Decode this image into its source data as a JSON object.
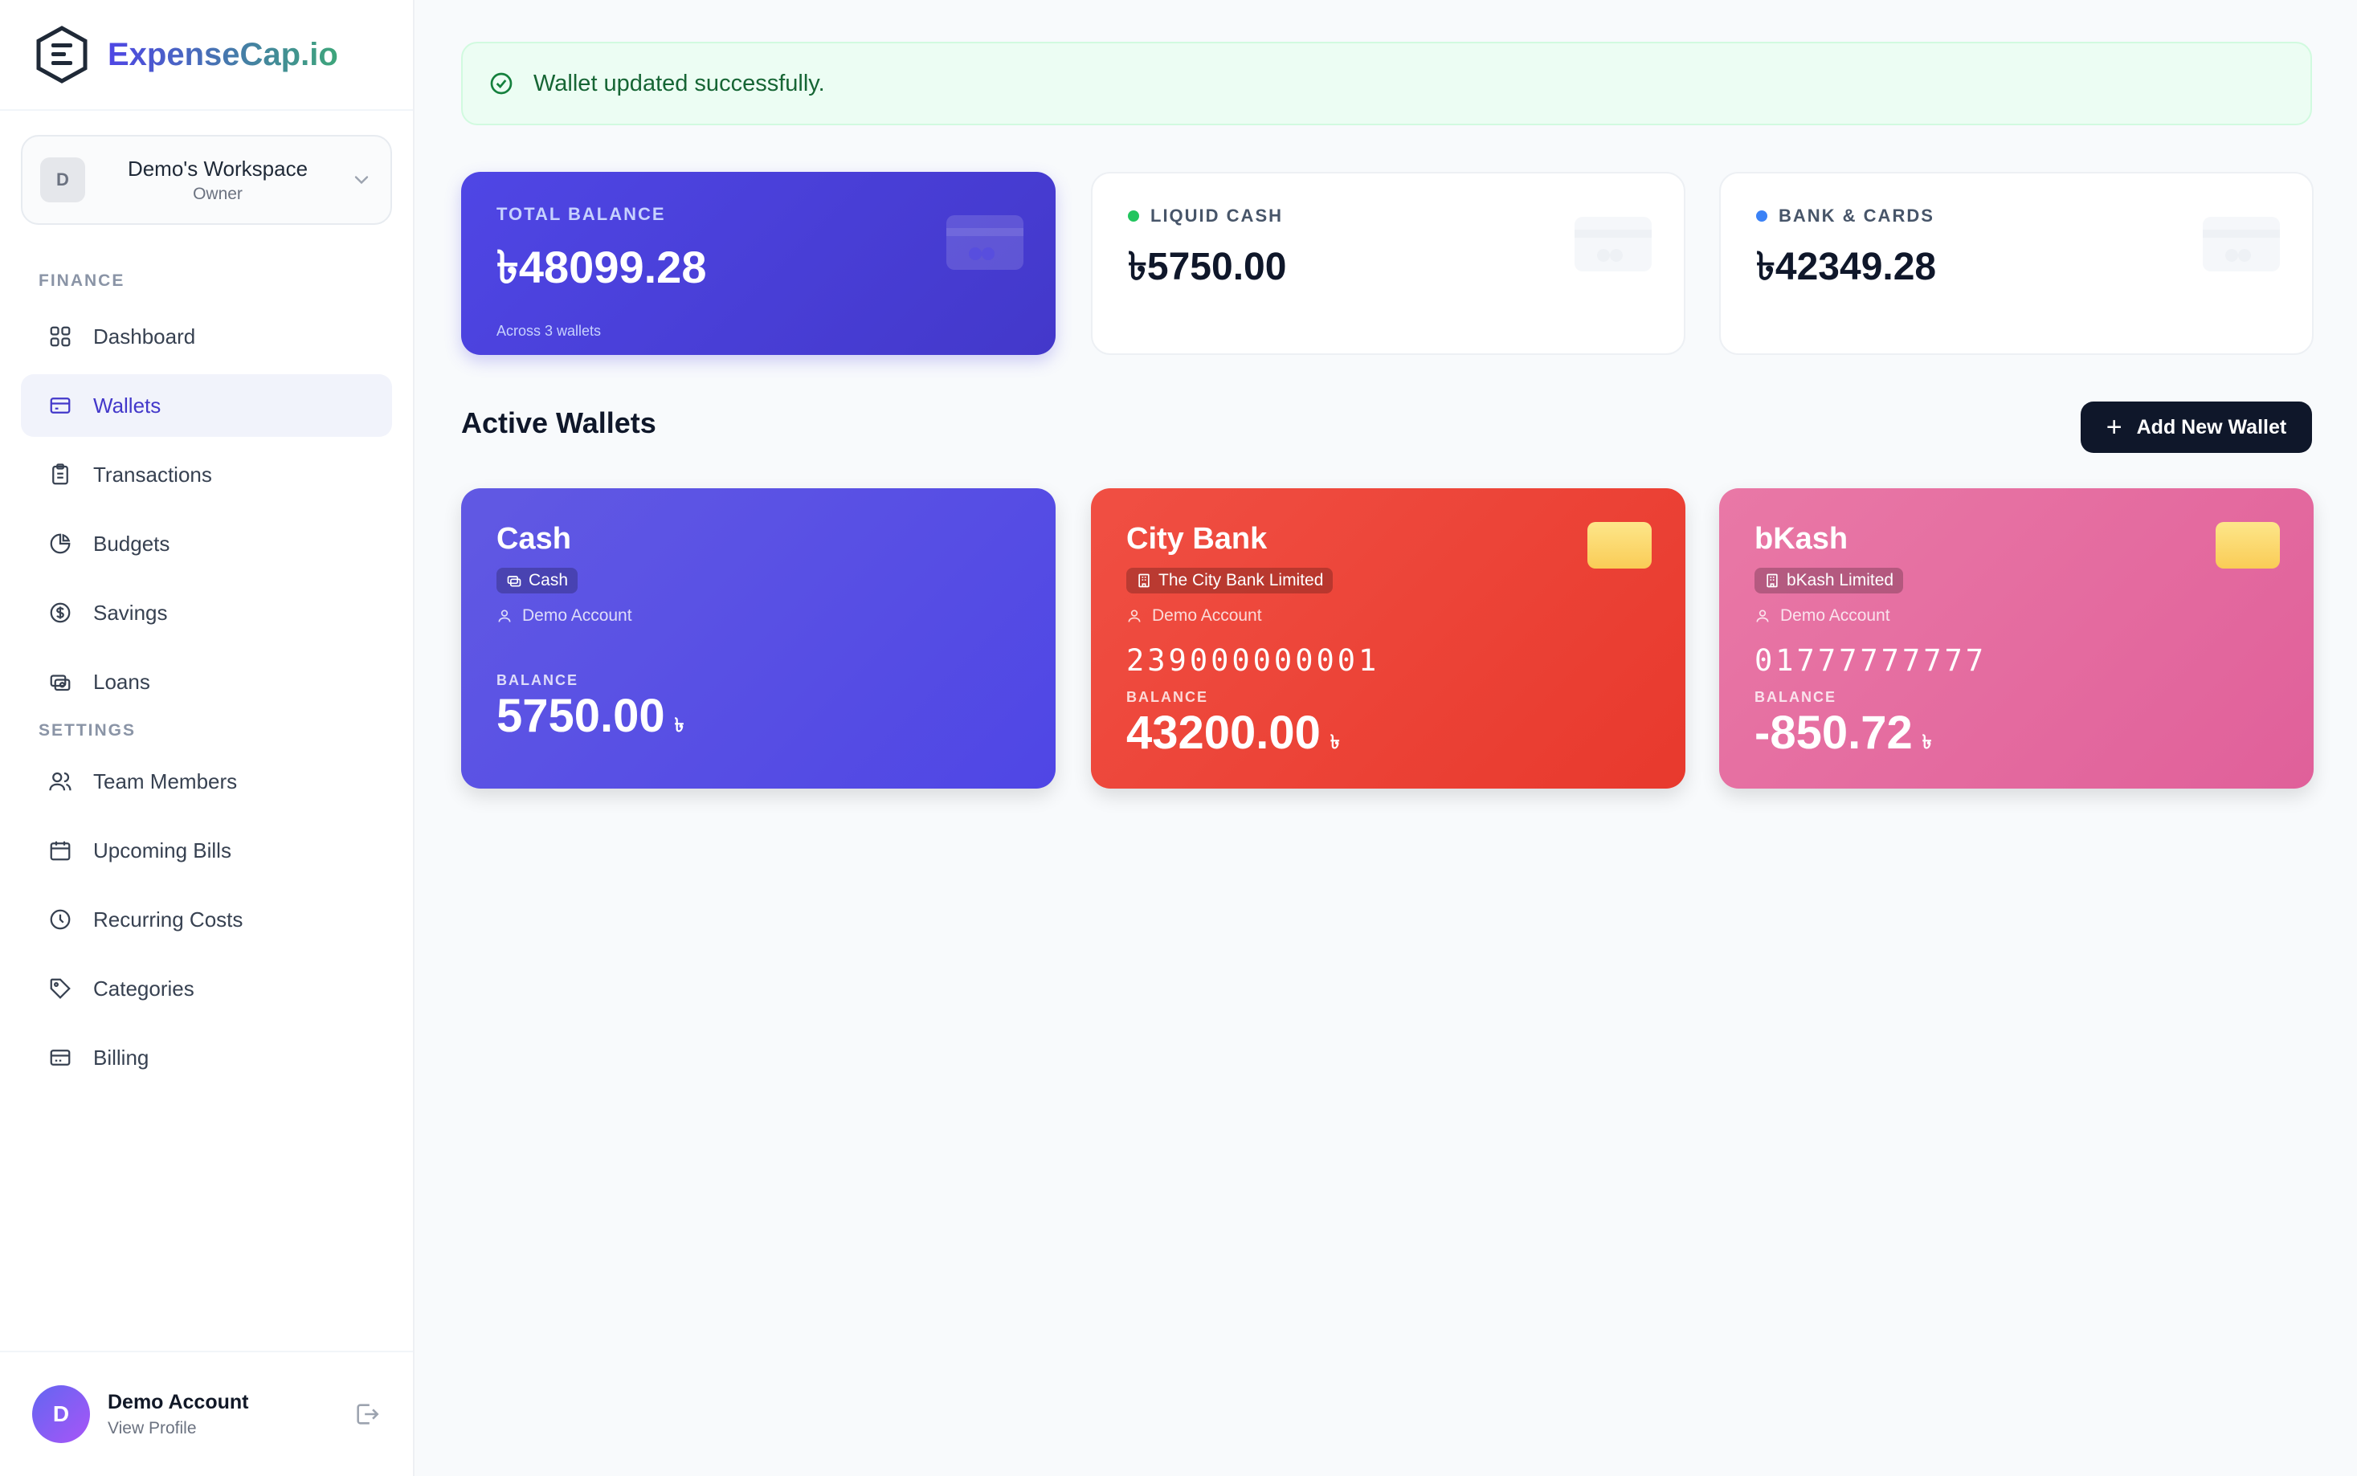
{
  "brand": {
    "name": "ExpenseCap.io",
    "accent": "#4f46e5"
  },
  "workspace": {
    "initial": "D",
    "name": "Demo's Workspace",
    "role": "Owner"
  },
  "nav": {
    "finance_label": "FINANCE",
    "settings_label": "SETTINGS",
    "finance": [
      {
        "label": "Dashboard",
        "icon": "grid-icon"
      },
      {
        "label": "Wallets",
        "icon": "wallet-icon",
        "active": true
      },
      {
        "label": "Transactions",
        "icon": "clipboard-icon"
      },
      {
        "label": "Budgets",
        "icon": "pie-chart-icon"
      },
      {
        "label": "Savings",
        "icon": "dollar-icon"
      },
      {
        "label": "Loans",
        "icon": "cash-icon"
      }
    ],
    "settings": [
      {
        "label": "Team Members",
        "icon": "users-icon"
      },
      {
        "label": "Upcoming Bills",
        "icon": "calendar-icon"
      },
      {
        "label": "Recurring Costs",
        "icon": "clock-icon"
      },
      {
        "label": "Categories",
        "icon": "tag-icon"
      },
      {
        "label": "Billing",
        "icon": "card-icon"
      }
    ]
  },
  "profile": {
    "initial": "D",
    "name": "Demo Account",
    "sub": "View Profile"
  },
  "alert": {
    "message": "Wallet updated successfully."
  },
  "stats": {
    "total": {
      "label": "TOTAL BALANCE",
      "value": "৳48099.28",
      "sub": "Across 3 wallets"
    },
    "liquid": {
      "label": "LIQUID CASH",
      "value": "৳5750.00",
      "dot": "#22c55e"
    },
    "bank": {
      "label": "BANK & CARDS",
      "value": "৳42349.28",
      "dot": "#3b82f6"
    }
  },
  "section": {
    "title": "Active Wallets",
    "add_label": "Add New Wallet"
  },
  "wallets": [
    {
      "name": "Cash",
      "tag": "Cash",
      "owner": "Demo Account",
      "number": "",
      "balance_label": "BALANCE",
      "balance": "5750.00",
      "currency": "৳"
    },
    {
      "name": "City Bank",
      "tag": "The City Bank Limited",
      "owner": "Demo Account",
      "number": "239000000001",
      "balance_label": "BALANCE",
      "balance": "43200.00",
      "currency": "৳"
    },
    {
      "name": "bKash",
      "tag": "bKash Limited",
      "owner": "Demo Account",
      "number": "01777777777",
      "balance_label": "BALANCE",
      "balance": "-850.72",
      "currency": "৳"
    }
  ]
}
